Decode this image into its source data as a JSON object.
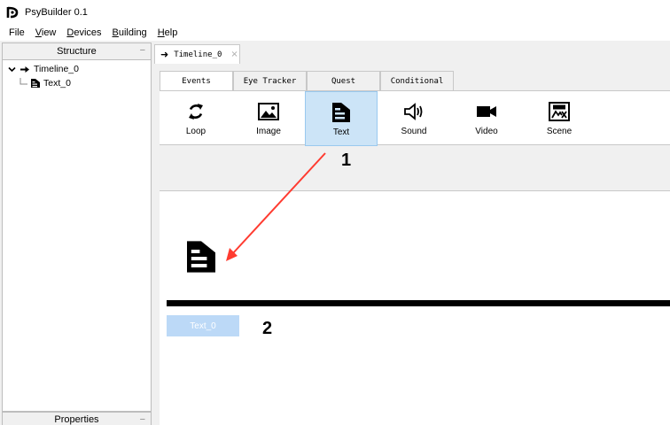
{
  "app": {
    "title": "PsyBuilder 0.1"
  },
  "menu": {
    "file": "File",
    "view": {
      "underlined": "V",
      "rest": "iew"
    },
    "devices": {
      "underlined": "D",
      "rest": "evices"
    },
    "building": {
      "underlined": "B",
      "rest": "uilding"
    },
    "help": {
      "underlined": "H",
      "rest": "elp"
    }
  },
  "structure_panel": {
    "title": "Structure",
    "collapse_glyph": "−",
    "tree": [
      {
        "label": "Timeline_0",
        "level": 0,
        "expanded": true
      },
      {
        "label": "Text_0",
        "level": 1
      }
    ]
  },
  "properties_panel": {
    "title": "Properties",
    "collapse_glyph": "−"
  },
  "document_tab": {
    "label": "Timeline_0",
    "close_glyph": "×"
  },
  "widget_tabs": [
    {
      "label": "Events",
      "active": true
    },
    {
      "label": "Eye Tracker"
    },
    {
      "label": "Quest"
    },
    {
      "label": "Conditional"
    }
  ],
  "toolbar": {
    "items": [
      {
        "label": "Loop",
        "icon": "loop-icon"
      },
      {
        "label": "Image",
        "icon": "image-icon"
      },
      {
        "label": "Text",
        "icon": "text-icon",
        "selected": true
      },
      {
        "label": "Sound",
        "icon": "sound-icon"
      },
      {
        "label": "Video",
        "icon": "video-icon"
      },
      {
        "label": "Scene",
        "icon": "scene-icon"
      }
    ]
  },
  "timeline": {
    "item_label": "Text_0"
  },
  "annotations": {
    "first": "1",
    "second": "2"
  },
  "colors": {
    "selection": "#cce4f7",
    "arrow": "#ff3b30",
    "item_label_bg": "#bcd9f7"
  }
}
